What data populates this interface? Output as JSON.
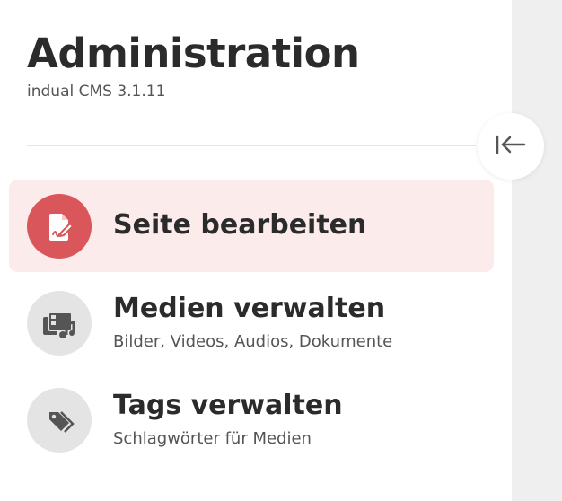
{
  "header": {
    "title": "Administration",
    "subtitle": "indual CMS 3.1.11"
  },
  "collapse_button": {
    "icon": "collapse-left-icon",
    "tooltip": ""
  },
  "nav": {
    "items": [
      {
        "label": "Seite bearbeiten",
        "description": "",
        "icon": "page-edit-icon",
        "active": true
      },
      {
        "label": "Medien verwalten",
        "description": "Bilder, Videos, Audios, Dokumente",
        "icon": "media-icon",
        "active": false
      },
      {
        "label": "Tags verwalten",
        "description": "Schlagwörter für Medien",
        "icon": "tags-icon",
        "active": false
      }
    ]
  },
  "colors": {
    "accent": "#d9565a",
    "active_bg": "#fbeceb",
    "icon_bg": "#e4e4e4",
    "text": "#2b2b2b",
    "muted": "#555555",
    "backdrop": "#efefef"
  }
}
